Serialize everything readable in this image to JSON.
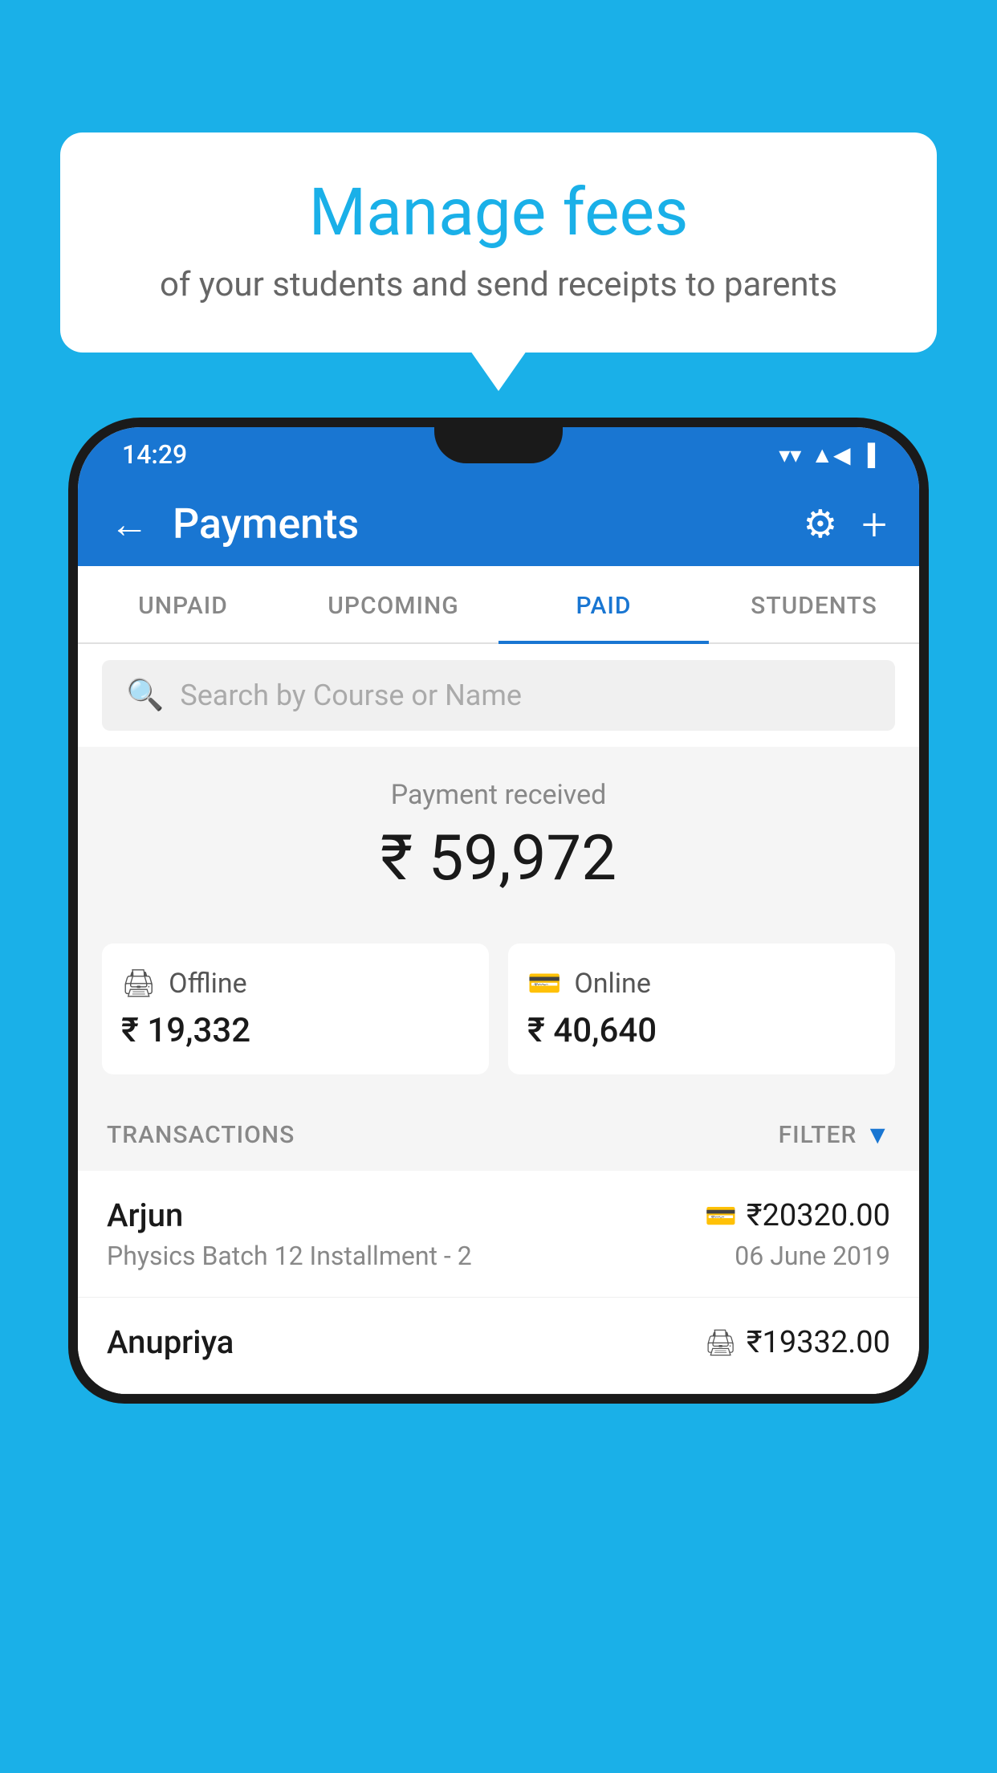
{
  "background_color": "#1ab0e8",
  "speech_bubble": {
    "title": "Manage fees",
    "subtitle": "of your students and send receipts to parents"
  },
  "status_bar": {
    "time": "14:29",
    "wifi_icon": "▾",
    "signal_icon": "▲",
    "battery_icon": "▮"
  },
  "app_header": {
    "back_label": "←",
    "title": "Payments",
    "gear_icon": "⚙",
    "plus_icon": "+"
  },
  "tabs": [
    {
      "label": "UNPAID",
      "active": false
    },
    {
      "label": "UPCOMING",
      "active": false
    },
    {
      "label": "PAID",
      "active": true
    },
    {
      "label": "STUDENTS",
      "active": false
    }
  ],
  "search": {
    "placeholder": "Search by Course or Name"
  },
  "payment_summary": {
    "label": "Payment received",
    "amount": "₹ 59,972",
    "cards": [
      {
        "icon": "🖨",
        "type": "Offline",
        "amount": "₹ 19,332"
      },
      {
        "icon": "💳",
        "type": "Online",
        "amount": "₹ 40,640"
      }
    ]
  },
  "transactions": {
    "label": "TRANSACTIONS",
    "filter_label": "FILTER",
    "rows": [
      {
        "name": "Arjun",
        "payment_type_icon": "💳",
        "amount": "₹20320.00",
        "course": "Physics Batch 12 Installment - 2",
        "date": "06 June 2019"
      },
      {
        "name": "Anupriya",
        "payment_type_icon": "🖨",
        "amount": "₹19332.00",
        "course": "",
        "date": ""
      }
    ]
  }
}
